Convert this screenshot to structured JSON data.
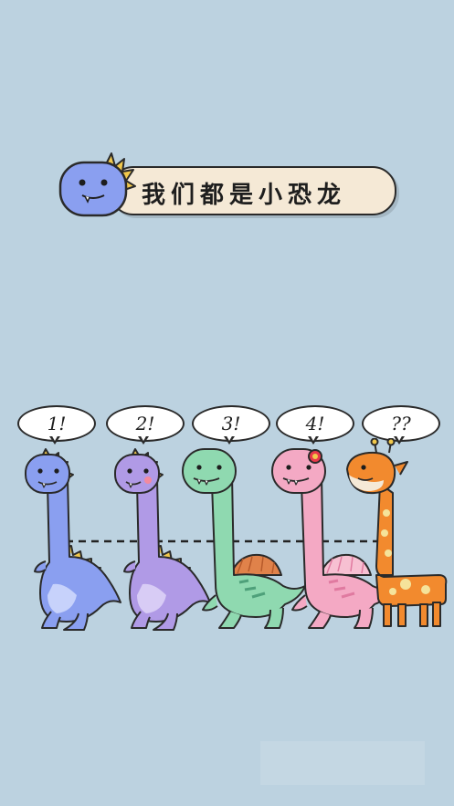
{
  "banner": {
    "title": "我们都是小恐龙"
  },
  "bubbles": [
    {
      "label": "1!"
    },
    {
      "label": "2!"
    },
    {
      "label": "3!"
    },
    {
      "label": "4!"
    },
    {
      "label": "??"
    }
  ],
  "colors": {
    "background": "#bcd2e0",
    "blue_dino": "#8a9ff0",
    "purple_dino": "#b09ae6",
    "green_dino": "#8fd9b0",
    "pink_dino": "#f4a9c4",
    "giraffe": "#f28a2e",
    "spikes": "#f2c94c"
  },
  "characters": [
    {
      "icon": "blue-dinosaur-icon"
    },
    {
      "icon": "purple-dinosaur-icon"
    },
    {
      "icon": "green-spinosaurus-icon"
    },
    {
      "icon": "pink-spinosaurus-icon"
    },
    {
      "icon": "giraffe-icon"
    }
  ]
}
